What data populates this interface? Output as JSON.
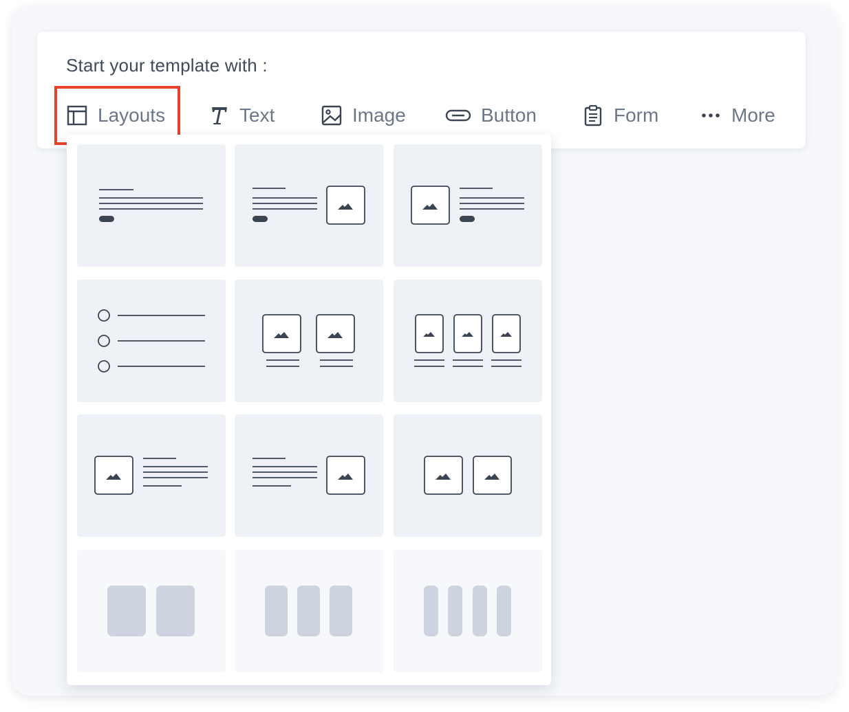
{
  "prompt": "Start your template with :",
  "toolbar": {
    "layouts_label": "Layouts",
    "text_label": "Text",
    "image_label": "Image",
    "button_label": "Button",
    "form_label": "Form",
    "more_label": "More"
  },
  "colors": {
    "highlight": "#e5432c",
    "icon": "#3a4452",
    "tile_bg": "#eef2f7",
    "column_block": "#cdd4df"
  },
  "layouts": [
    {
      "row": 1,
      "items": [
        "text-with-button",
        "text-left-image-right-button",
        "image-left-text-right-button"
      ]
    },
    {
      "row": 2,
      "items": [
        "bullet-list",
        "two-image-columns",
        "three-image-columns"
      ]
    },
    {
      "row": 3,
      "items": [
        "image-left-text-right",
        "text-left-image-right",
        "two-images"
      ]
    },
    {
      "row": 4,
      "items": [
        "two-columns",
        "three-columns",
        "four-columns"
      ]
    }
  ]
}
